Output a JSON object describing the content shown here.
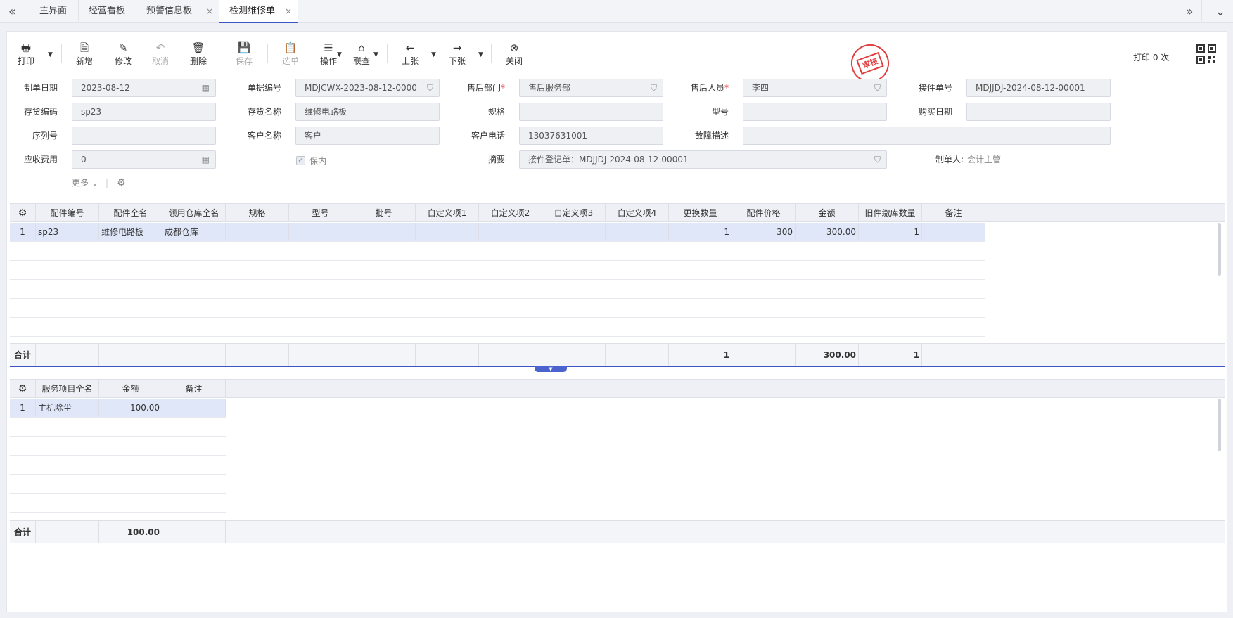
{
  "tabs": {
    "nav_left": "«",
    "nav_right": "»",
    "nav_down": "⌄",
    "items": [
      {
        "label": "主界面"
      },
      {
        "label": "经营看板"
      },
      {
        "label": "预警信息板",
        "close": "×"
      },
      {
        "label": "检测维修单",
        "close": "×"
      }
    ]
  },
  "toolbar": {
    "print": "打印",
    "add": "新增",
    "edit": "修改",
    "cancel": "取消",
    "delete": "删除",
    "save": "保存",
    "select": "选单",
    "operate": "操作",
    "linkquery": "联查",
    "prev": "上张",
    "next": "下张",
    "close": "关闭"
  },
  "stamp": "审核",
  "print_count": "打印 0 次",
  "form": {
    "date_label": "制单日期",
    "date_value": "2023-08-12",
    "docno_label": "单据编号",
    "docno_value": "MDJCWX-2023-08-12-0000",
    "dept_label": "售后部门",
    "dept_value": "售后服务部",
    "staff_label": "售后人员",
    "staff_value": "李四",
    "receipt_label": "接件单号",
    "receipt_value": "MDJJDJ-2024-08-12-00001",
    "stockcode_label": "存货编码",
    "stockcode_value": "sp23",
    "stockname_label": "存货名称",
    "stockname_value": "维修电路板",
    "spec_label": "规格",
    "spec_value": "",
    "model_label": "型号",
    "model_value": "",
    "purchase_label": "购买日期",
    "purchase_value": "",
    "serial_label": "序列号",
    "serial_value": "",
    "customer_label": "客户名称",
    "customer_value": "客户",
    "phone_label": "客户电话",
    "phone_value": "13037631001",
    "fault_label": "故障描述",
    "fault_value": "",
    "fee_label": "应收费用",
    "fee_value": "0",
    "warranty_label": "保内",
    "summary_label": "摘要",
    "summary_value": "接件登记单：MDJJDJ-2024-08-12-00001",
    "maker_label": "制单人:",
    "maker_value": "会计主管",
    "required_mark": "*",
    "more_label": "更多"
  },
  "parts_grid": {
    "columns": [
      "配件编号",
      "配件全名",
      "领用仓库全名",
      "规格",
      "型号",
      "批号",
      "自定义项1",
      "自定义项2",
      "自定义项3",
      "自定义项4",
      "更换数量",
      "配件价格",
      "金额",
      "旧件缴库数量",
      "备注"
    ],
    "rows": [
      {
        "no": "1",
        "code": "sp23",
        "name": "维修电路板",
        "warehouse": "成都仓库",
        "spec": "",
        "model": "",
        "batch": "",
        "c1": "",
        "c2": "",
        "c3": "",
        "c4": "",
        "qty": "1",
        "price": "300",
        "amount": "300.00",
        "old_qty": "1",
        "note": ""
      }
    ],
    "footer": {
      "label": "合计",
      "qty": "1",
      "amount": "300.00",
      "old_qty": "1"
    }
  },
  "service_grid": {
    "columns": [
      "服务项目全名",
      "金额",
      "备注"
    ],
    "rows": [
      {
        "no": "1",
        "name": "主机除尘",
        "amount": "100.00",
        "note": ""
      }
    ],
    "footer": {
      "label": "合计",
      "amount": "100.00"
    }
  },
  "colors": {
    "accent": "#3b55c8",
    "stamp": "#e23c3c",
    "selected_row": "#dfe7f9"
  }
}
